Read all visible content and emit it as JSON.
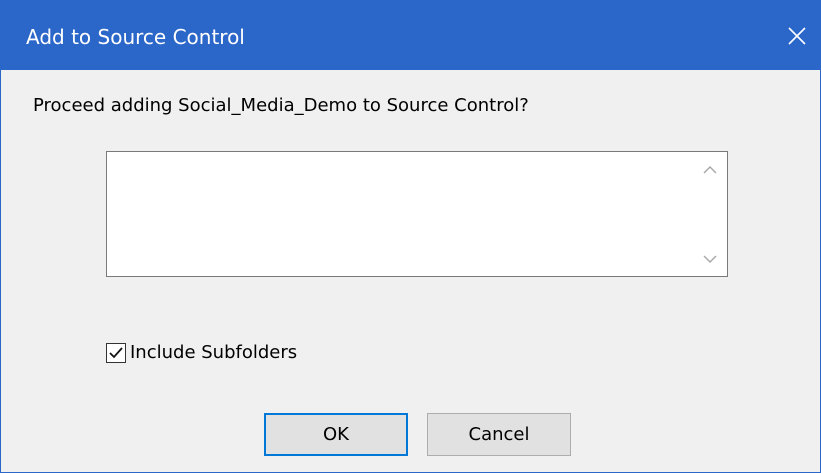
{
  "window": {
    "title": "Add to Source Control",
    "close_glyph": "×",
    "accent_color": "#2b66c9"
  },
  "prompt": {
    "text": "Proceed adding Social_Media_Demo to Source Control?"
  },
  "comment_box": {
    "value": "",
    "placeholder": ""
  },
  "options": {
    "include_subfolders": {
      "label": "Include Subfolders",
      "checked": true
    }
  },
  "buttons": {
    "ok_label": "OK",
    "cancel_label": "Cancel"
  },
  "icons": {
    "close": "close-icon",
    "scroll_up": "chevron-up-icon",
    "scroll_down": "chevron-down-icon",
    "checkmark": "checkmark-icon"
  }
}
